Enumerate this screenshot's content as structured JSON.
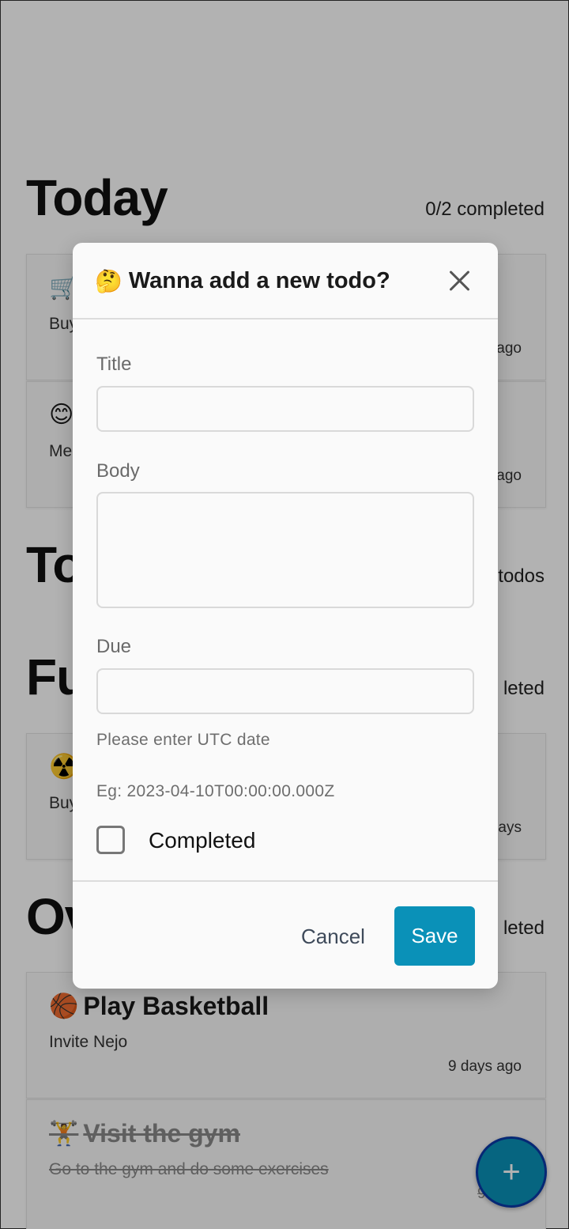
{
  "sections": {
    "today": {
      "title": "Today",
      "meta": "0/2 completed"
    },
    "todo": {
      "title": "To",
      "meta": "todos"
    },
    "future": {
      "title": "Fu",
      "meta": "leted"
    },
    "overdue": {
      "title": "Ov",
      "meta": "leted"
    }
  },
  "today_cards": [
    {
      "emoji": "🛒",
      "body": "Buy",
      "time": "ago"
    },
    {
      "emoji": "😊",
      "body": "Me",
      "time": "ago"
    }
  ],
  "future_cards": [
    {
      "emoji": "☢️",
      "body": "Buy",
      "time": "ays"
    }
  ],
  "overdue_cards": [
    {
      "emoji": "🏀",
      "title": "Play Basketball",
      "body": "Invite Nejo",
      "time": "9 days ago"
    },
    {
      "emoji": "🏋️",
      "title": "Visit the gym",
      "body": "Go to the gym and do some exercises",
      "time": "9 days"
    }
  ],
  "fab": {
    "icon": "plus-icon",
    "glyph": "+"
  },
  "modal": {
    "emoji": "🤔",
    "title": "Wanna add a new todo?",
    "close_icon": "close-icon",
    "title_label": "Title",
    "title_value": "",
    "body_label": "Body",
    "body_value": "",
    "due_label": "Due",
    "due_value": "",
    "due_hint": "Please enter UTC date",
    "due_example": "Eg: 2023-04-10T00:00:00.000Z",
    "completed_label": "Completed",
    "completed_checked": false,
    "cancel_label": "Cancel",
    "save_label": "Save"
  },
  "colors": {
    "accent": "#0a91b8",
    "overlay": "rgba(0,0,0,0.30)",
    "modal_bg": "#fafafa"
  }
}
